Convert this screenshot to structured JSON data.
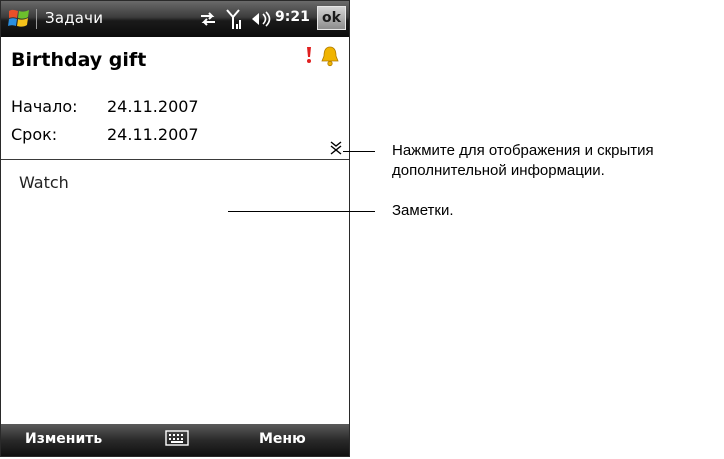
{
  "titlebar": {
    "app_title": "Задачи",
    "time": "9:21",
    "ok_label": "ok"
  },
  "task": {
    "title": "Birthday gift",
    "start_label": "Начало:",
    "start_value": "24.11.2007",
    "due_label": "Срок:",
    "due_value": "24.11.2007",
    "notes": "Watch"
  },
  "softkeys": {
    "left": "Изменить",
    "right": "Меню"
  },
  "callouts": {
    "expand_line1": "Нажмите для отображения и скрытия",
    "expand_line2": "дополнительной информации.",
    "notes": "Заметки."
  },
  "icons": {
    "start": "windows-start-icon",
    "connectivity": "connectivity-icon",
    "signal": "signal-icon",
    "volume": "volume-icon",
    "priority": "priority-exclamation-icon",
    "reminder": "bell-icon",
    "expand": "expand-collapse-icon",
    "keyboard": "keyboard-icon"
  },
  "colors": {
    "priority": "#e02020",
    "bell": "#f0b400"
  }
}
